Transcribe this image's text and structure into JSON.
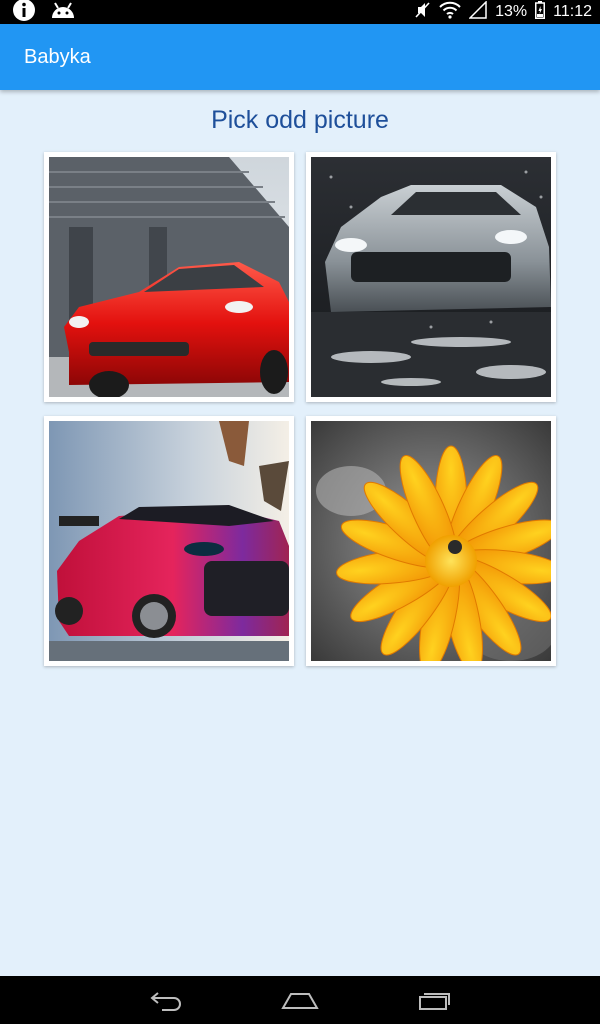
{
  "status_bar": {
    "battery_text": "13%",
    "time": "11:12",
    "icons": [
      "info-icon",
      "android-icon",
      "mute-icon",
      "wifi-icon",
      "signal-icon",
      "battery-icon"
    ]
  },
  "app_bar": {
    "title": "Babyka"
  },
  "main": {
    "prompt": "Pick odd picture",
    "pictures": [
      {
        "name": "red-sports-car",
        "kind": "car"
      },
      {
        "name": "silver-sports-car",
        "kind": "car"
      },
      {
        "name": "magenta-sports-car",
        "kind": "car"
      },
      {
        "name": "orange-flower",
        "kind": "flower"
      }
    ]
  },
  "nav_bar": {
    "buttons": [
      "back-icon",
      "home-icon",
      "recent-apps-icon"
    ]
  },
  "colors": {
    "app_bar": "#2196f3",
    "background": "#e3f0fb",
    "prompt_text": "#1e4f9a"
  }
}
